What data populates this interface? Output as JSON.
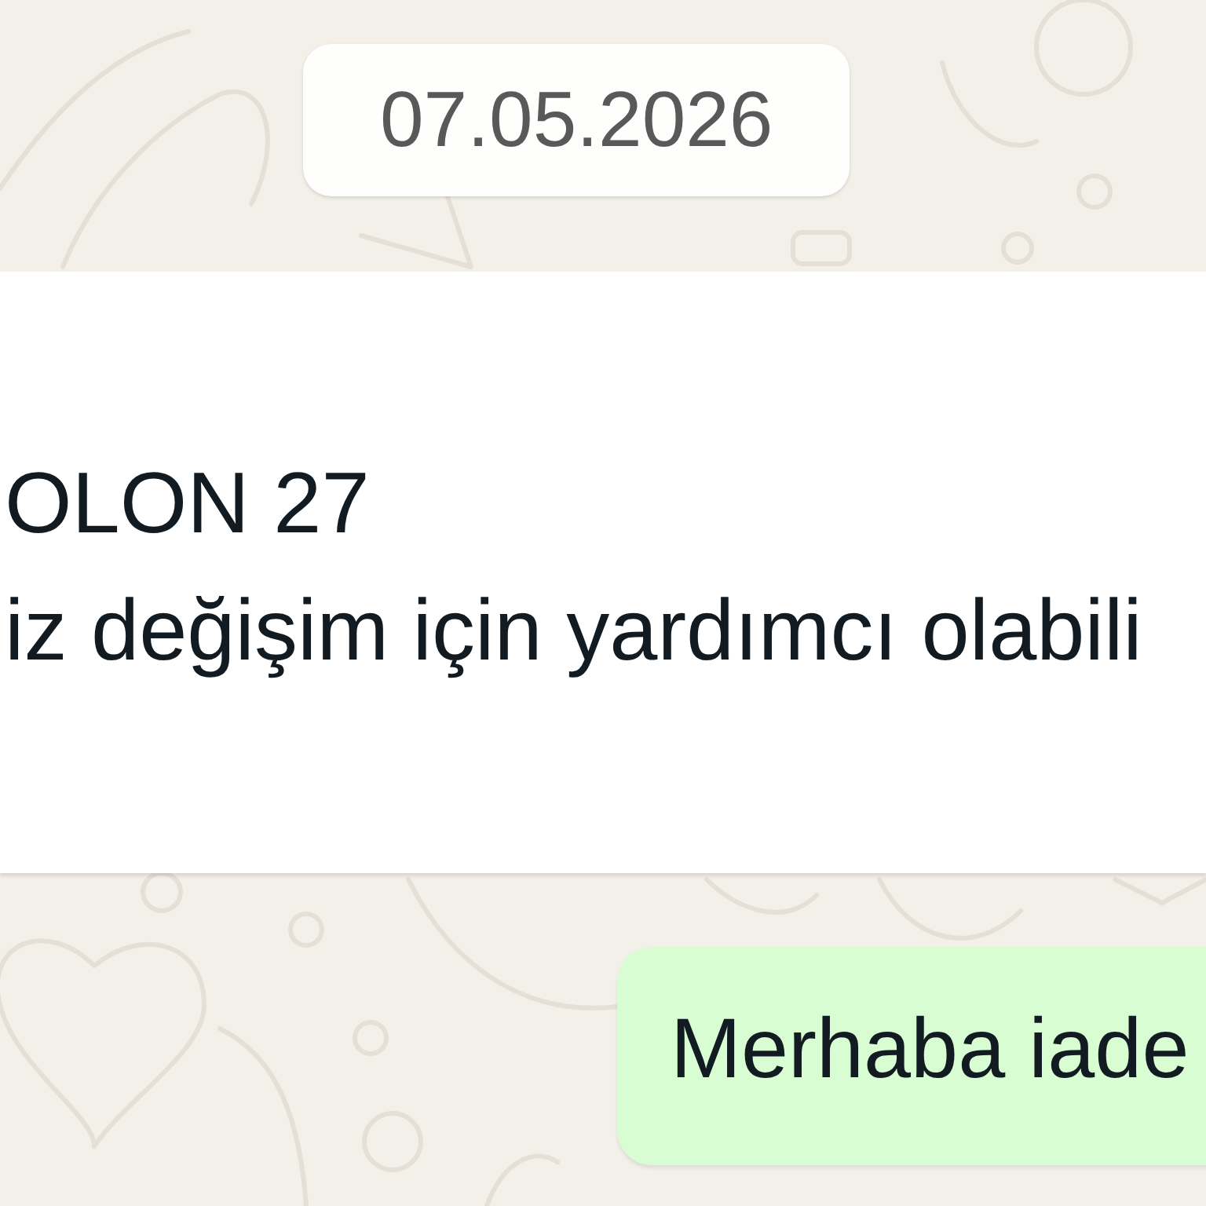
{
  "date_badge": {
    "text": "07.05.2026"
  },
  "messages": [
    {
      "kind": "incoming",
      "lines": [
        "OLON 27",
        "iz değişim için yardımcı olabili"
      ]
    },
    {
      "kind": "outgoing",
      "lines": [
        "Merhaba iade"
      ]
    }
  ]
}
